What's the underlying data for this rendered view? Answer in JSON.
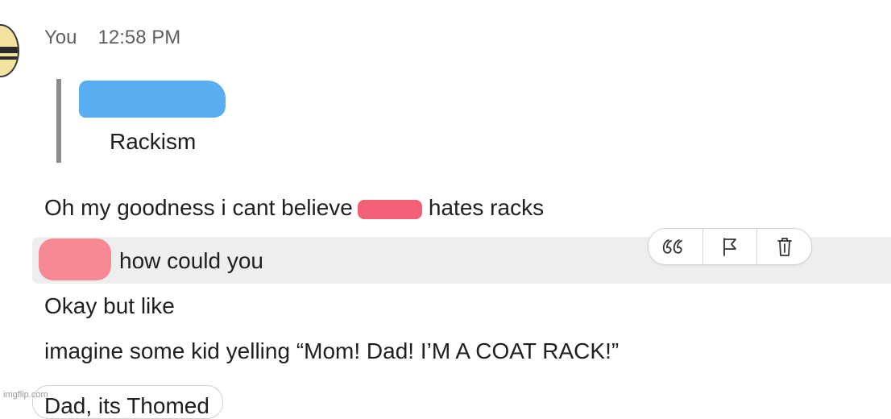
{
  "header": {
    "sender": "You",
    "time": "12:58 PM"
  },
  "quote": {
    "text": "Rackism"
  },
  "messages": [
    {
      "before": "Oh my goodness i cant believe",
      "after": "hates racks"
    },
    {
      "text": "how could you"
    },
    {
      "text": "Okay but like"
    },
    {
      "text": "imagine some kid yelling “Mom! Dad! I’M A COAT RACK!”"
    }
  ],
  "partial": {
    "text": "Dad, its Thomed"
  },
  "actions": [
    {
      "icon": "quote-icon"
    },
    {
      "icon": "flag-icon"
    },
    {
      "icon": "trash-icon"
    }
  ],
  "watermark": "imgflip.com",
  "colors": {
    "redact_blue": "#46a5f0",
    "redact_red": "#f2506a",
    "hover_bg": "#eeeeee"
  }
}
